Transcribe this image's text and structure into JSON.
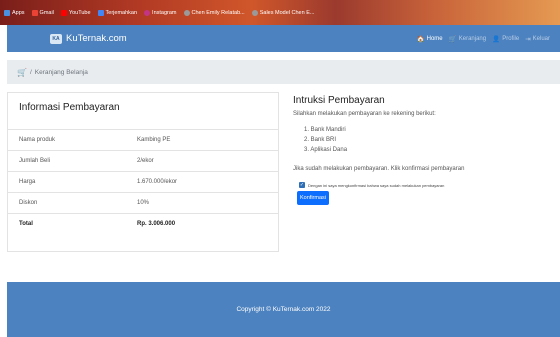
{
  "bookmarks": [
    {
      "label": "Apps",
      "color": "#4a90e2",
      "icon": "apps-grid-icon"
    },
    {
      "label": "Gmail",
      "color": "#ea4335",
      "icon": "gmail-icon"
    },
    {
      "label": "YouTube",
      "color": "#ff0000",
      "icon": "youtube-icon"
    },
    {
      "label": "Terjemahkan",
      "color": "#4285f4",
      "icon": "translate-icon"
    },
    {
      "label": "Instagram",
      "color": "#c13584",
      "icon": "instagram-icon"
    },
    {
      "label": "Chen Emily Relatab...",
      "color": "#7a7a7a",
      "icon": "globe-icon"
    },
    {
      "label": "Sales Model Chen E...",
      "color": "#7a7a7a",
      "icon": "globe-icon"
    }
  ],
  "navbar": {
    "brand": "KuTernak.com",
    "logo_text": "KA",
    "links": [
      {
        "label": "Home",
        "icon": "home-icon",
        "glyph": "🏠",
        "active": true
      },
      {
        "label": "Keranjang",
        "icon": "cart-icon",
        "glyph": "🛒",
        "active": false
      },
      {
        "label": "Profile",
        "icon": "user-icon",
        "glyph": "👤",
        "active": false
      },
      {
        "label": "Keluar",
        "icon": "logout-icon",
        "glyph": "⇥",
        "active": false
      }
    ]
  },
  "breadcrumb": {
    "icon": "cart-icon",
    "separator": "/",
    "current": "Keranjang Belanja"
  },
  "payment_info": {
    "title": "Informasi Pembayaran",
    "rows": [
      {
        "label": "Nama produk",
        "value": "Kambing PE"
      },
      {
        "label": "Jumlah Beli",
        "value": "2/ekor"
      },
      {
        "label": "Harga",
        "value": "1.670.000/ekor"
      },
      {
        "label": "Diskon",
        "value": "10%"
      },
      {
        "label": "Total",
        "value": "Rp. 3.006.000"
      }
    ]
  },
  "instructions": {
    "title": "Intruksi Pembayaran",
    "subtitle": "Silahkan melakukan pembayaran ke rekening berikut:",
    "banks": [
      "1. Bank Mandiri",
      "2. Bank BRI",
      "3. Aplikasi Dana"
    ],
    "note": "Jika sudah melakukan pembayaran. Klik konfirmasi pembayaran",
    "checkbox_label": "Dengan ini saya mengkonfirmasi bahwa saya sudah melakukan pembayaran",
    "checkbox_checked": true,
    "confirm_button": "Konfirmasi"
  },
  "footer": {
    "text": "Copyright © KuTernak.com 2022"
  },
  "colors": {
    "navbar": "#4c82bf",
    "footer": "#4c82bf",
    "button": "#0d6efd",
    "breadcrumb_bg": "#e9ecef"
  }
}
